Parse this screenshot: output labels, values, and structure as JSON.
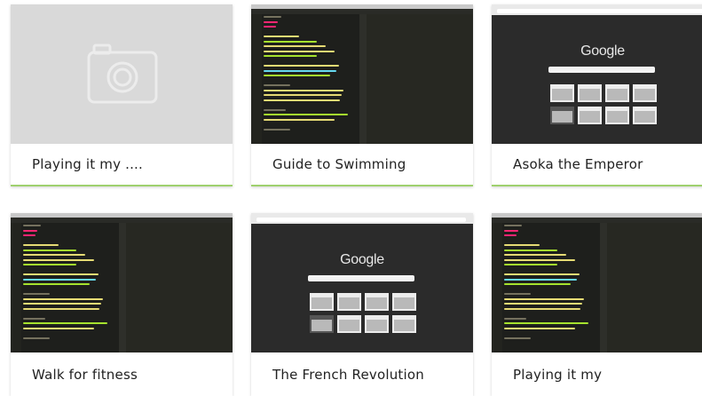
{
  "cards": [
    {
      "title": "Playing it my ...."
    },
    {
      "title": "Guide to Swimming"
    },
    {
      "title": "Asoka the Emperor"
    },
    {
      "title": "Walk for fitness"
    },
    {
      "title": "The French Revolution"
    },
    {
      "title": "Playing it my"
    }
  ],
  "browser": {
    "logo": "Google"
  },
  "colors": {
    "accent_underline": "#9fd06e",
    "placeholder_bg": "#d9d9d9",
    "editor_bg": "#1e1f1c"
  }
}
